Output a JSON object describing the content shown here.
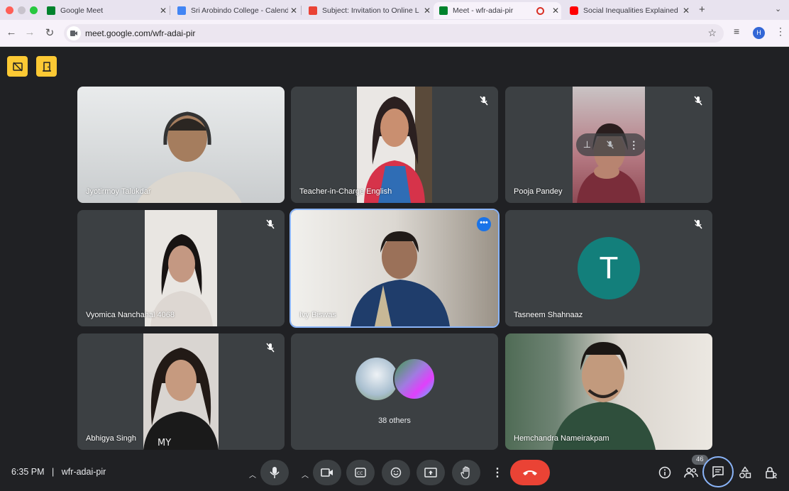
{
  "tabs": [
    {
      "title": "Google Meet",
      "favicon": "meet-favicon",
      "color": "#00832d"
    },
    {
      "title": "Sri Arobindo College - Calend",
      "favicon": "calendar-favicon",
      "color": "#4285f4"
    },
    {
      "title": "Subject: Invitation to Online L",
      "favicon": "gmail-favicon",
      "color": "#ea4335"
    },
    {
      "title": "Meet - wfr-adai-pir",
      "favicon": "meet-favicon",
      "color": "#00832d"
    },
    {
      "title": "Social Inequalities Explained |",
      "favicon": "youtube-favicon",
      "color": "#ff0000"
    }
  ],
  "toolbar": {
    "url": "meet.google.com/wfr-adai-pir",
    "profile_initial": "H"
  },
  "participants": [
    {
      "name": "Jyotirmoy Talukdar",
      "muted": false
    },
    {
      "name": "Teacher-in-Charge English",
      "muted": true
    },
    {
      "name": "Pooja Pandey",
      "muted": true
    },
    {
      "name": "Vyomica Nanchahal 4068",
      "muted": true
    },
    {
      "name": "Ivy Biswas",
      "muted": false
    },
    {
      "name": "Tasneem Shahnaaz",
      "muted": true,
      "avatar_letter": "T",
      "avatar_color": "#137f7b"
    },
    {
      "name": "Abhigya Singh",
      "muted": true
    },
    {
      "name": "38 others"
    },
    {
      "name": "Hemchandra Nameirakpam",
      "muted": false
    }
  ],
  "footer": {
    "time": "6:35 PM",
    "separator": "|",
    "meeting_code": "wfr-adai-pir",
    "people_count": "46"
  },
  "colors": {
    "end_call": "#ea4335",
    "accent": "#8ab4f8",
    "badge": "#fcc934"
  }
}
